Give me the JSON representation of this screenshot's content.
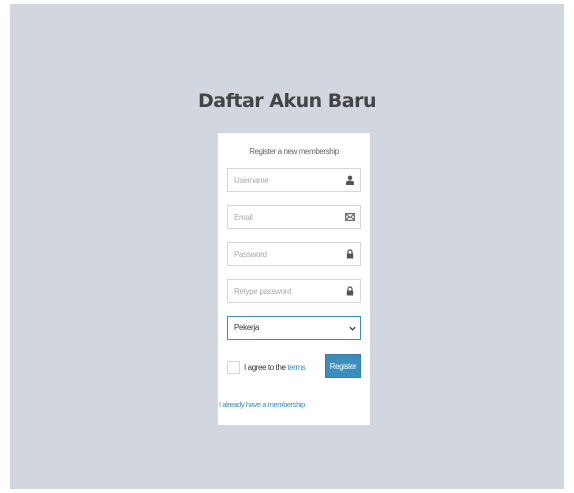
{
  "page": {
    "title": "Daftar Akun Baru"
  },
  "form": {
    "message": "Register a new membership",
    "username_placeholder": "Username",
    "email_placeholder": "Email",
    "password_placeholder": "Password",
    "retype_placeholder": "Retype password",
    "role_selected": "Pekerja",
    "agree_prefix": "I agree to the ",
    "agree_terms": "terms",
    "register_label": "Register",
    "login_link": "I already have a membership"
  },
  "icons": {
    "username": "user-icon",
    "email": "envelope-icon",
    "password": "lock-icon",
    "retype": "lock-icon",
    "select": "chevron-down-icon"
  },
  "colors": {
    "background": "#d2d6de",
    "primary": "#3c8dbc",
    "card": "#ffffff"
  }
}
